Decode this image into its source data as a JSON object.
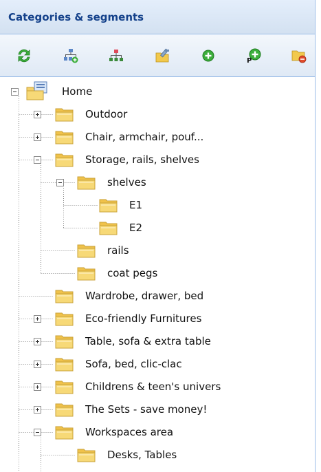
{
  "panel": {
    "title": "Categories & segments"
  },
  "toolbar": {
    "buttons": [
      {
        "icon": "refresh-icon"
      },
      {
        "icon": "expand-tree-icon"
      },
      {
        "icon": "collapse-tree-icon"
      },
      {
        "icon": "edit-icon"
      },
      {
        "icon": "add-icon"
      },
      {
        "icon": "add-product-icon"
      },
      {
        "icon": "delete-folder-icon"
      }
    ]
  },
  "colors": {
    "header_text": "#15428b",
    "border": "#99bbe8",
    "folder": "#f5d16b",
    "add_green": "#3cae3c",
    "remove_red": "#e04a2a"
  },
  "tree": {
    "root": "Home",
    "nodes": [
      {
        "label": "Outdoor",
        "state": "collapsed"
      },
      {
        "label": "Chair, armchair, pouf...",
        "state": "collapsed"
      },
      {
        "label": "Storage, rails, shelves",
        "state": "expanded"
      },
      {
        "label": "shelves",
        "state": "expanded"
      },
      {
        "label": "E1",
        "state": "leaf"
      },
      {
        "label": "E2",
        "state": "leaf"
      },
      {
        "label": "rails",
        "state": "leaf"
      },
      {
        "label": "coat pegs",
        "state": "leaf"
      },
      {
        "label": "Wardrobe, drawer, bed",
        "state": "leaf"
      },
      {
        "label": "Eco-friendly Furnitures",
        "state": "collapsed"
      },
      {
        "label": "Table, sofa & extra table",
        "state": "collapsed"
      },
      {
        "label": "Sofa, bed, clic-clac",
        "state": "collapsed"
      },
      {
        "label": "Childrens & teen's univers",
        "state": "collapsed"
      },
      {
        "label": "The Sets - save money!",
        "state": "collapsed"
      },
      {
        "label": "Workspaces area",
        "state": "expanded"
      },
      {
        "label": "Desks, Tables",
        "state": "leaf"
      }
    ]
  }
}
